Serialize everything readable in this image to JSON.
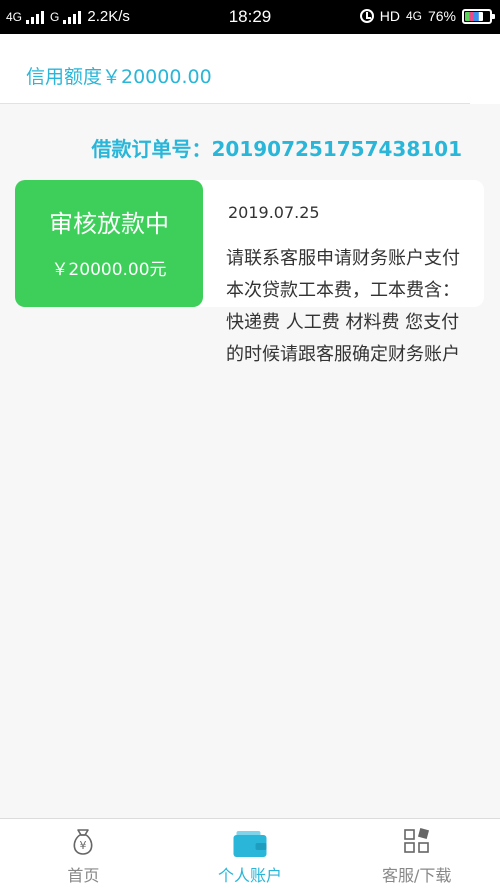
{
  "status_bar": {
    "network1": "4G",
    "network2": "G",
    "speed": "2.2K/s",
    "time": "18:29",
    "hd": "HD",
    "network3": "4G",
    "battery": "76%",
    "battery_level": 0.76
  },
  "credit": {
    "label": "信用额度￥20000.00"
  },
  "order": {
    "label": "借款订单号：2019072517574381 01",
    "full": "借款订单号：201907251757438101"
  },
  "record": {
    "status": "审核放款中",
    "amount": "￥20000.00元",
    "date": "2019.07.25",
    "message": "请联系客服申请财务账户支付本次贷款工本费，工本费含：快递费 人工费 材料费 您支付的时候请跟客服确定财务账户"
  },
  "tabs": [
    {
      "label": "首页",
      "icon": "money-bag-icon"
    },
    {
      "label": "个人账户",
      "icon": "wallet-icon"
    },
    {
      "label": "客服/下载",
      "icon": "apps-grid-icon"
    }
  ],
  "colors": {
    "accent": "#29b6d8",
    "status_green": "#3dcf5a"
  }
}
